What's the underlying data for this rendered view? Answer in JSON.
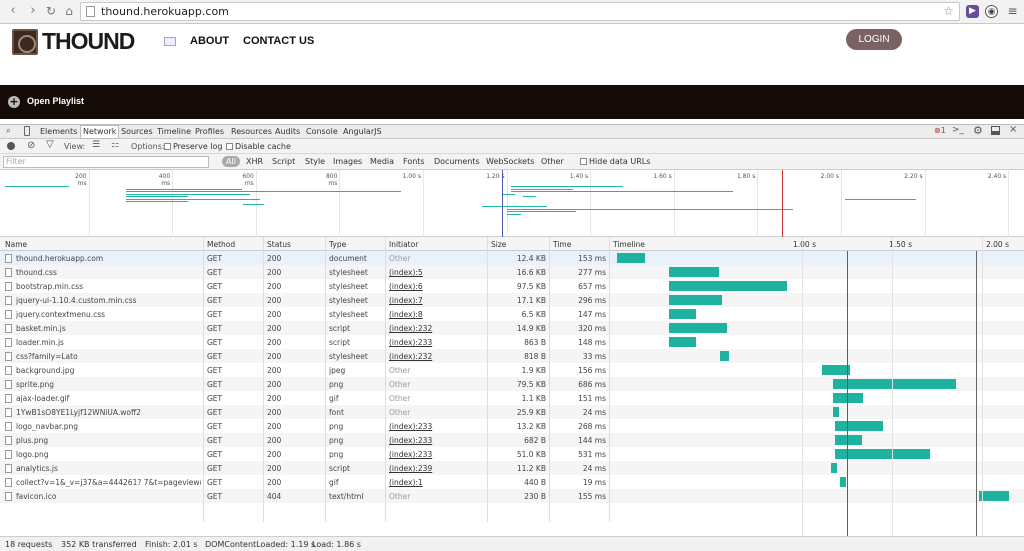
{
  "browser": {
    "url": "thound.herokuapp.com"
  },
  "site": {
    "logo_text": "THOUND",
    "nav": [
      "ABOUT",
      "CONTACT US"
    ],
    "login_label": "LOGIN",
    "playlist_label": "Open Playlist"
  },
  "devtools": {
    "tabs": [
      "Elements",
      "Network",
      "Sources",
      "Timeline",
      "Profiles",
      "Resources",
      "Audits",
      "Console",
      "AngularJS"
    ],
    "selected_tab": "Network",
    "error_count": "1",
    "toolbar": {
      "view_label": "View:",
      "options_label": "Options:",
      "preserve_log": "Preserve log",
      "disable_cache": "Disable cache"
    },
    "filter": {
      "placeholder": "Filter",
      "types": [
        "All",
        "XHR",
        "Script",
        "Style",
        "Images",
        "Media",
        "Fonts",
        "Documents",
        "WebSockets",
        "Other"
      ],
      "hide_data_urls": "Hide data URLs"
    },
    "overview_ticks": [
      "200 ms",
      "400 ms",
      "600 ms",
      "800 ms",
      "1.00 s",
      "1.20 s",
      "1.40 s",
      "1.60 s",
      "1.80 s",
      "2.00 s",
      "2.20 s",
      "2.40 s"
    ],
    "columns": [
      "Name",
      "Method",
      "Status",
      "Type",
      "Initiator",
      "Size",
      "Time",
      "Timeline"
    ],
    "timeline_ticks": [
      "1.00 s",
      "1.50 s",
      "2.00 s"
    ],
    "requests": [
      {
        "name": "thound.herokuapp.com",
        "method": "GET",
        "status": "200",
        "type": "document",
        "initiator": "Other",
        "size": "12.4 KB",
        "time": "153 ms",
        "start_s": 0.0,
        "dur_s": 0.153
      },
      {
        "name": "thound.css",
        "method": "GET",
        "status": "200",
        "type": "stylesheet",
        "initiator": "(index):5",
        "size": "16.6 KB",
        "time": "277 ms",
        "start_s": 0.29,
        "dur_s": 0.277
      },
      {
        "name": "bootstrap.min.css",
        "method": "GET",
        "status": "200",
        "type": "stylesheet",
        "initiator": "(index):6",
        "size": "97.5 KB",
        "time": "657 ms",
        "start_s": 0.29,
        "dur_s": 0.657
      },
      {
        "name": "jquery-ui-1.10.4.custom.min.css",
        "method": "GET",
        "status": "200",
        "type": "stylesheet",
        "initiator": "(index):7",
        "size": "17.1 KB",
        "time": "296 ms",
        "start_s": 0.29,
        "dur_s": 0.296
      },
      {
        "name": "jquery.contextmenu.css",
        "method": "GET",
        "status": "200",
        "type": "stylesheet",
        "initiator": "(index):8",
        "size": "6.5 KB",
        "time": "147 ms",
        "start_s": 0.29,
        "dur_s": 0.147
      },
      {
        "name": "basket.min.js",
        "method": "GET",
        "status": "200",
        "type": "script",
        "initiator": "(index):232",
        "size": "14.9 KB",
        "time": "320 ms",
        "start_s": 0.29,
        "dur_s": 0.32
      },
      {
        "name": "loader.min.js",
        "method": "GET",
        "status": "200",
        "type": "script",
        "initiator": "(index):233",
        "size": "863 B",
        "time": "148 ms",
        "start_s": 0.29,
        "dur_s": 0.148
      },
      {
        "name": "css?family=Lato",
        "method": "GET",
        "status": "200",
        "type": "stylesheet",
        "initiator": "(index):232",
        "size": "818 B",
        "time": "33 ms",
        "start_s": 0.57,
        "dur_s": 0.05
      },
      {
        "name": "background.jpg",
        "method": "GET",
        "status": "200",
        "type": "jpeg",
        "initiator": "Other",
        "size": "1.9 KB",
        "time": "156 ms",
        "start_s": 1.14,
        "dur_s": 0.156
      },
      {
        "name": "sprite.png",
        "method": "GET",
        "status": "200",
        "type": "png",
        "initiator": "Other",
        "size": "79.5 KB",
        "time": "686 ms",
        "start_s": 1.2,
        "dur_s": 0.686
      },
      {
        "name": "ajax-loader.gif",
        "method": "GET",
        "status": "200",
        "type": "gif",
        "initiator": "Other",
        "size": "1.1 KB",
        "time": "151 ms",
        "start_s": 1.2,
        "dur_s": 0.165
      },
      {
        "name": "1YwB1sO8YE1Lyjf12WNiUA.woff2",
        "method": "GET",
        "status": "200",
        "type": "font",
        "initiator": "Other",
        "size": "25.9 KB",
        "time": "24 ms",
        "start_s": 1.2,
        "dur_s": 0.035
      },
      {
        "name": "logo_navbar.png",
        "method": "GET",
        "status": "200",
        "type": "png",
        "initiator": "(index):233",
        "size": "13.2 KB",
        "time": "268 ms",
        "start_s": 1.21,
        "dur_s": 0.268
      },
      {
        "name": "plus.png",
        "method": "GET",
        "status": "200",
        "type": "png",
        "initiator": "(index):233",
        "size": "682 B",
        "time": "144 ms",
        "start_s": 1.21,
        "dur_s": 0.15
      },
      {
        "name": "logo.png",
        "method": "GET",
        "status": "200",
        "type": "png",
        "initiator": "(index):233",
        "size": "51.0 KB",
        "time": "531 ms",
        "start_s": 1.21,
        "dur_s": 0.531
      },
      {
        "name": "analytics.js",
        "method": "GET",
        "status": "200",
        "type": "script",
        "initiator": "(index):239",
        "size": "11.2 KB",
        "time": "24 ms",
        "start_s": 1.19,
        "dur_s": 0.03
      },
      {
        "name": "collect?v=1&_v=j37&a=444261? 7&t=pageview&_s=...",
        "method": "GET",
        "status": "200",
        "type": "gif",
        "initiator": "(index):1",
        "size": "440 B",
        "time": "19 ms",
        "start_s": 1.24,
        "dur_s": 0.03
      },
      {
        "name": "favicon.ico",
        "method": "GET",
        "status": "404",
        "type": "text/html",
        "initiator": "Other",
        "size": "230 B",
        "time": "155 ms",
        "start_s": 2.01,
        "dur_s": 0.17
      }
    ],
    "dom_content_loaded_s": 1.19,
    "load_s": 1.86,
    "status": {
      "requests": "18 requests",
      "transferred": "352 KB transferred",
      "finish": "Finish: 2.01 s",
      "dcl": "DOMContentLoaded: 1.19 s",
      "load": "Load: 1.86 s"
    },
    "colors": {
      "bar": "#1fb29f",
      "dcl_line": "#4a5aa8",
      "load_line": "#666666"
    }
  }
}
